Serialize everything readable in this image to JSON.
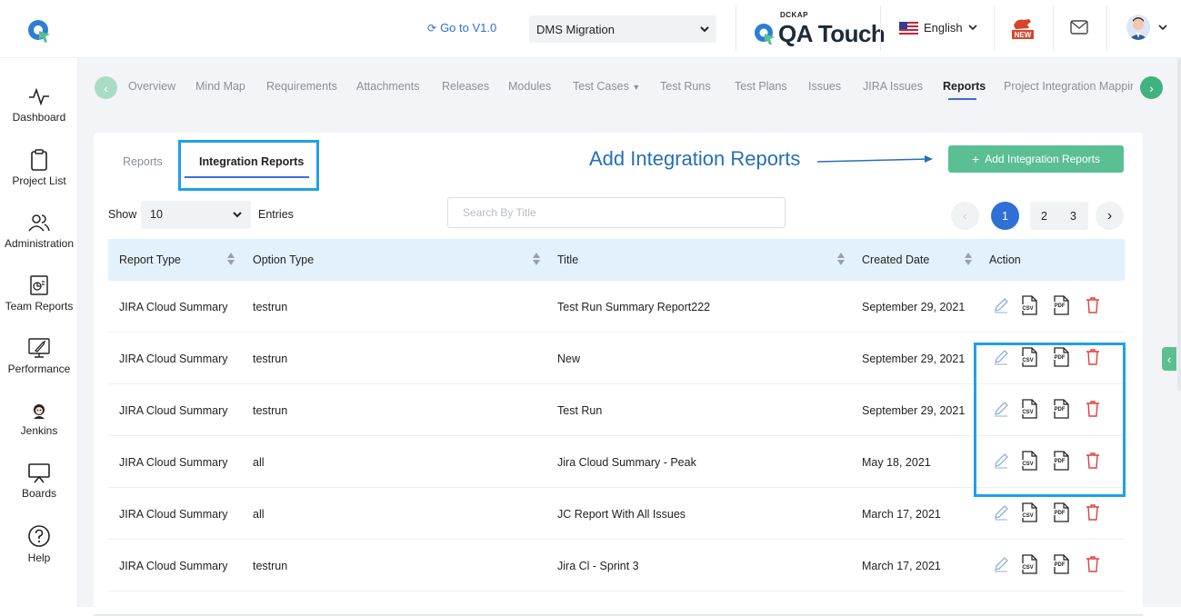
{
  "header": {
    "goto_label": "Go to V1.0",
    "project_selected": "DMS Migration",
    "brand_small": "DCKAP",
    "brand_name": "QA Touch",
    "language": "English",
    "new_badge": "NEW"
  },
  "sidebar": {
    "items": [
      {
        "label": "Dashboard",
        "icon": "pulse-icon"
      },
      {
        "label": "Project List",
        "icon": "clipboard-icon"
      },
      {
        "label": "Administration",
        "icon": "users-icon"
      },
      {
        "label": "Team Reports",
        "icon": "report-icon"
      },
      {
        "label": "Performance",
        "icon": "rocket-icon"
      },
      {
        "label": "Jenkins",
        "icon": "jenkins-icon"
      },
      {
        "label": "Boards",
        "icon": "board-icon"
      },
      {
        "label": "Help",
        "icon": "help-icon"
      }
    ]
  },
  "nav": {
    "tabs": [
      {
        "label": "Overview"
      },
      {
        "label": "Mind Map"
      },
      {
        "label": "Requirements"
      },
      {
        "label": "Attachments"
      },
      {
        "label": "Releases"
      },
      {
        "label": "Modules"
      },
      {
        "label": "Test Cases"
      },
      {
        "label": "Test Runs"
      },
      {
        "label": "Test Plans"
      },
      {
        "label": "Issues"
      },
      {
        "label": "JIRA Issues"
      },
      {
        "label": "Reports"
      },
      {
        "label": "Project Integration Mappin"
      }
    ],
    "active": "Reports"
  },
  "reports": {
    "tab_reports": "Reports",
    "tab_integration": "Integration Reports",
    "annotation": "Add Integration Reports",
    "add_button": "Add Integration Reports",
    "show_label": "Show",
    "entries_value": "10",
    "entries_label": "Entries",
    "search_placeholder": "Search By Title",
    "pagination": {
      "prev": "‹",
      "pages": [
        "1",
        "2",
        "3"
      ],
      "current": "1",
      "next": "›"
    },
    "columns": [
      "Report Type",
      "Option Type",
      "Title",
      "Created Date",
      "Action"
    ],
    "rows": [
      {
        "report_type": "JIRA Cloud Summary",
        "option_type": "testrun",
        "title": "Test Run Summary Report222",
        "created": "September 29, 2021"
      },
      {
        "report_type": "JIRA Cloud Summary",
        "option_type": "testrun",
        "title": "New",
        "created": "September 29, 2021"
      },
      {
        "report_type": "JIRA Cloud Summary",
        "option_type": "testrun",
        "title": "Test Run",
        "created": "September 29, 2021"
      },
      {
        "report_type": "JIRA Cloud Summary",
        "option_type": "all",
        "title": "Jira Cloud Summary - Peak",
        "created": "May 18, 2021"
      },
      {
        "report_type": "JIRA Cloud Summary",
        "option_type": "all",
        "title": "JC Report With All Issues",
        "created": "March 17, 2021"
      },
      {
        "report_type": "JIRA Cloud Summary",
        "option_type": "testrun",
        "title": "Jira Cl - Sprint 3",
        "created": "March 17, 2021"
      }
    ],
    "action_icons": [
      "edit-icon",
      "csv-icon",
      "pdf-icon",
      "delete-icon"
    ],
    "csv_text": "CSV",
    "pdf_text": "PDF"
  },
  "colors": {
    "accent": "#5bbf94",
    "link": "#2f6fd6",
    "highlight": "#1fa1e8",
    "delete": "#e0413a",
    "table_head": "#e3f1fd"
  }
}
